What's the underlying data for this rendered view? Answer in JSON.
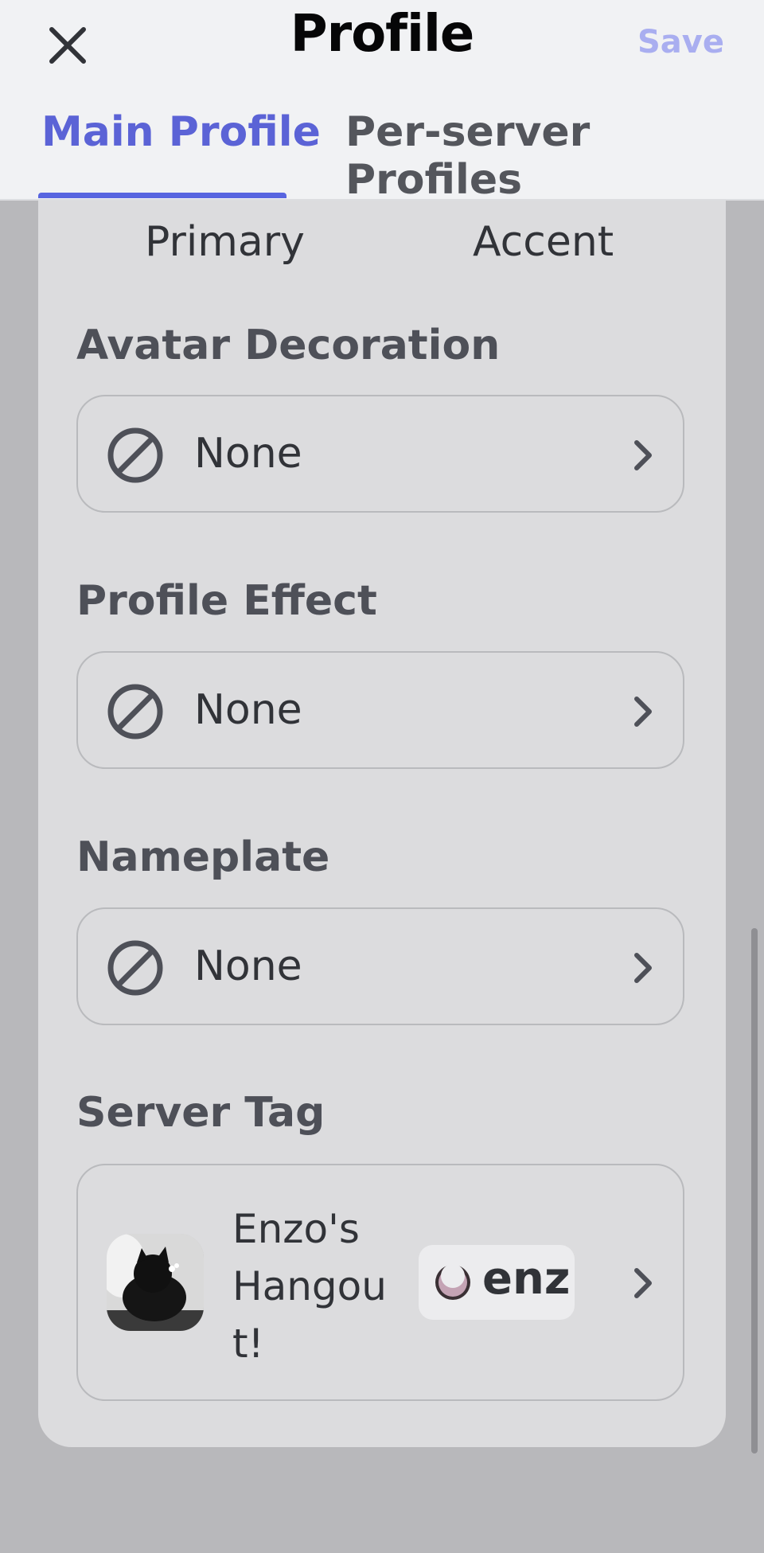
{
  "header": {
    "title": "Profile",
    "close_icon": "close-icon",
    "save_label": "Save"
  },
  "tabs": [
    {
      "label": "Main Profile",
      "active": true
    },
    {
      "label": "Per-server Profiles",
      "active": false
    }
  ],
  "colors": {
    "primary_label": "Primary",
    "accent_label": "Accent"
  },
  "sections": {
    "avatar_decoration": {
      "title": "Avatar Decoration",
      "value": "None"
    },
    "profile_effect": {
      "title": "Profile Effect",
      "value": "None"
    },
    "nameplate": {
      "title": "Nameplate",
      "value": "None"
    },
    "server_tag": {
      "title": "Server Tag",
      "server_name": "Enzo's Hangout!",
      "tag": "enz"
    }
  },
  "theme": {
    "accent": "#5865e0",
    "save_disabled": "#a9aef0",
    "background": "#dcdcde"
  }
}
